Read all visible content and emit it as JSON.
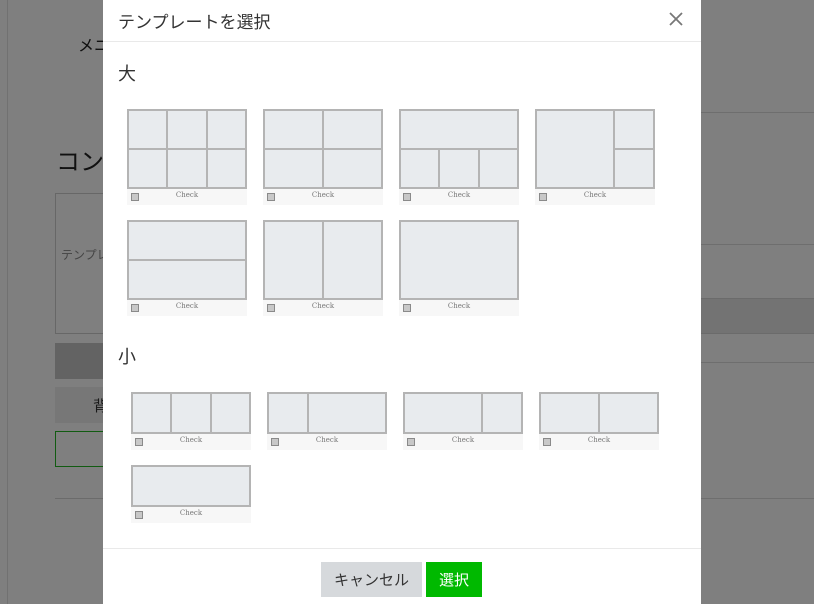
{
  "background": {
    "menu_label": "メニ",
    "page_title": "コン",
    "textarea_placeholder": "テンプレ",
    "button_label": "背"
  },
  "modal": {
    "title": "テンプレートを選択",
    "close_icon": "close-icon",
    "sections": [
      {
        "label": "大",
        "templates": [
          {
            "id": "large-6",
            "check_label": "Check"
          },
          {
            "id": "large-4",
            "check_label": "Check"
          },
          {
            "id": "large-1-3",
            "check_label": "Check"
          },
          {
            "id": "large-1-2",
            "check_label": "Check"
          },
          {
            "id": "large-2-rows",
            "check_label": "Check"
          },
          {
            "id": "large-2-cols",
            "check_label": "Check"
          },
          {
            "id": "large-1",
            "check_label": "Check"
          }
        ]
      },
      {
        "label": "小",
        "templates": [
          {
            "id": "small-3",
            "check_label": "Check"
          },
          {
            "id": "small-1-2",
            "check_label": "Check"
          },
          {
            "id": "small-2-1",
            "check_label": "Check"
          },
          {
            "id": "small-2",
            "check_label": "Check"
          },
          {
            "id": "small-1",
            "check_label": "Check"
          }
        ]
      }
    ],
    "footer": {
      "cancel_label": "キャンセル",
      "select_label": "選択"
    }
  },
  "colors": {
    "accent": "#00b900",
    "cancel_bg": "#d6d9dc",
    "tile_fill": "#e8ebee",
    "tile_border": "#b4b4b4"
  }
}
